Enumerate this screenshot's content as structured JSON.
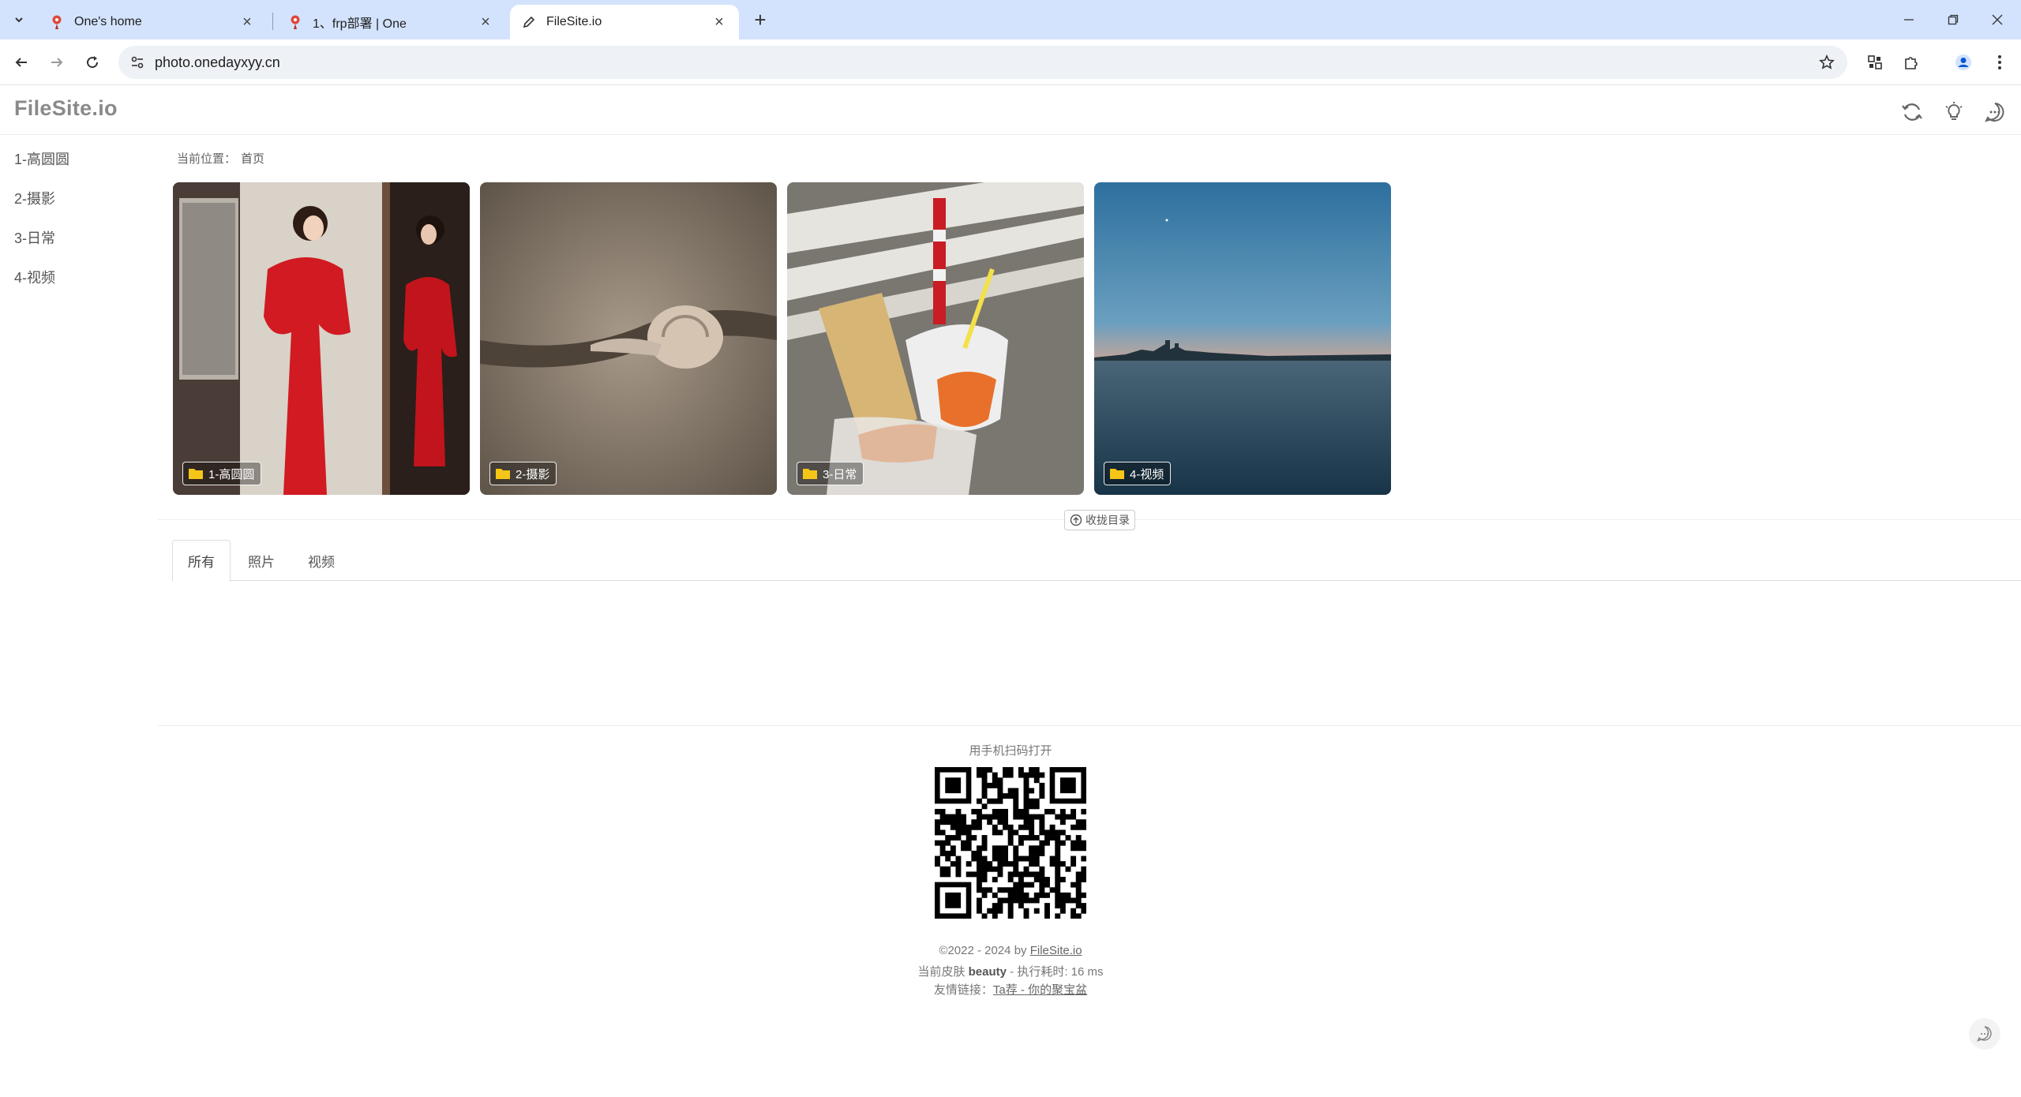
{
  "browser": {
    "tabs": [
      {
        "title": "One's home",
        "active": false
      },
      {
        "title": "1、frp部署 | One",
        "active": false
      },
      {
        "title": "FileSite.io",
        "active": true
      }
    ],
    "url": "photo.onedayxyy.cn"
  },
  "site": {
    "logo": "FileSite.io",
    "sidebar": [
      "1-高圆圆",
      "2-摄影",
      "3-日常",
      "4-视频"
    ],
    "breadcrumb": {
      "label": "当前位置：",
      "home": "首页"
    },
    "folders": [
      {
        "label": "1-高圆圆"
      },
      {
        "label": "2-摄影"
      },
      {
        "label": "3-日常"
      },
      {
        "label": "4-视频"
      }
    ],
    "collapse_label": "收拢目录",
    "filter_tabs": [
      "所有",
      "照片",
      "视频"
    ],
    "footer": {
      "scan_label": "用手机扫码打开",
      "copyright_prefix": "©2022 - 2024 by ",
      "copyright_link": "FileSite.io",
      "skin_prefix": "当前皮肤 ",
      "skin_name": "beauty",
      "skin_suffix": " - 执行耗时: 16 ms",
      "links_prefix": "友情链接：",
      "links_link": "Ta荐 - 你的聚宝盆"
    }
  },
  "colors": {
    "tabbar_bg": "#d3e3fd",
    "folder_icon": "#f5c518",
    "logo": "#8a8a8a"
  }
}
